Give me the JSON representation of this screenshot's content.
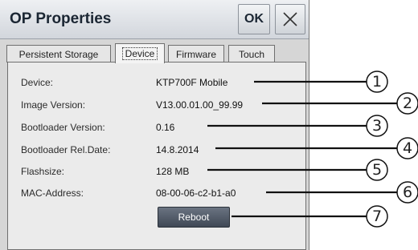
{
  "window": {
    "title": "OP Properties",
    "ok_label": "OK",
    "close_icon": "close-icon"
  },
  "tabs": [
    {
      "label": "Persistent Storage",
      "active": false
    },
    {
      "label": "Device",
      "active": true
    },
    {
      "label": "Firmware",
      "active": false
    },
    {
      "label": "Touch",
      "active": false
    }
  ],
  "device": {
    "rows": [
      {
        "label": "Device:",
        "value": "KTP700F Mobile",
        "callout": "1"
      },
      {
        "label": "Image Version:",
        "value": "V13.00.01.00_99.99",
        "callout": "2"
      },
      {
        "label": "Bootloader Version:",
        "value": "0.16",
        "callout": "3"
      },
      {
        "label": "Bootloader Rel.Date:",
        "value": "14.8.2014",
        "callout": "4"
      },
      {
        "label": "Flashsize:",
        "value": "128 MB",
        "callout": "5"
      },
      {
        "label": "MAC-Address:",
        "value": "08-00-06-c2-b1-a0",
        "callout": "6"
      }
    ],
    "reboot_label": "Reboot",
    "reboot_callout": "7"
  },
  "colors": {
    "reboot_button": "#4f5866",
    "title_text": "#1b2633"
  }
}
